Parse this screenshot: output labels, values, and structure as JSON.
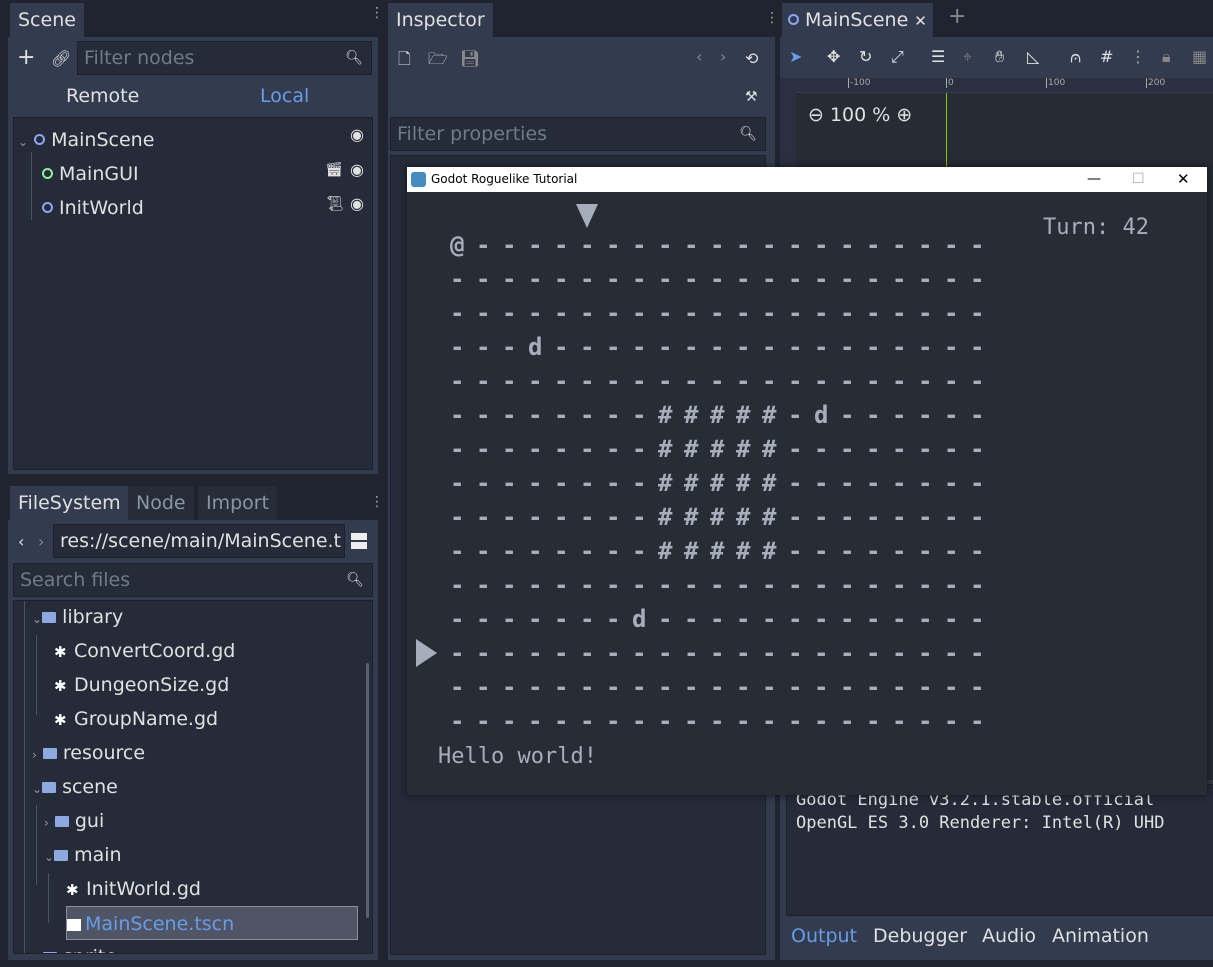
{
  "scene_dock": {
    "tab": "Scene",
    "filter_placeholder": "Filter nodes",
    "remote": "Remote",
    "local": "Local",
    "nodes": [
      {
        "name": "MainScene",
        "color": "#8da5f3"
      },
      {
        "name": "MainGUI",
        "color": "#8eef97"
      },
      {
        "name": "InitWorld",
        "color": "#8da5f3"
      }
    ]
  },
  "filesystem_dock": {
    "tabs": [
      "FileSystem",
      "Node",
      "Import"
    ],
    "path": "res://scene/main/MainScene.t",
    "search_placeholder": "Search files",
    "items": [
      {
        "label": "library",
        "type": "folder",
        "expanded": true
      },
      {
        "label": "ConvertCoord.gd",
        "type": "script"
      },
      {
        "label": "DungeonSize.gd",
        "type": "script"
      },
      {
        "label": "GroupName.gd",
        "type": "script"
      },
      {
        "label": "resource",
        "type": "folder",
        "expanded": false
      },
      {
        "label": "scene",
        "type": "folder",
        "expanded": true
      },
      {
        "label": "gui",
        "type": "folder",
        "expanded": false
      },
      {
        "label": "main",
        "type": "folder",
        "expanded": true
      },
      {
        "label": "InitWorld.gd",
        "type": "script"
      },
      {
        "label": "MainScene.tscn",
        "type": "scene",
        "selected": true
      },
      {
        "label": "sprite",
        "type": "folder",
        "expanded": false
      }
    ]
  },
  "inspector": {
    "tab": "Inspector",
    "filter_placeholder": "Filter properties"
  },
  "editor": {
    "scene_tab": "MainScene",
    "zoom": "100 %",
    "ruler_labels": [
      "-100",
      "0",
      "100",
      "200"
    ],
    "accent": "#699ce8"
  },
  "bottom_panel": {
    "output_lines": [
      "Godot Engine v3.2.1.stable.official",
      "OpenGL ES 3.0 Renderer: Intel(R) UHD"
    ],
    "tabs": [
      "Output",
      "Debugger",
      "Audio",
      "Animation"
    ]
  },
  "game_window": {
    "title": "Godot Roguelike Tutorial",
    "turn": "Turn: 42",
    "message": "Hello world!",
    "map": [
      "@--------------------",
      "---------------------",
      "---------------------",
      "---d-----------------",
      "---------------------",
      "--------#####-d------",
      "--------#####--------",
      "--------#####--------",
      "--------#####--------",
      "--------#####--------",
      "---------------------",
      "-------d-------------",
      "---------------------",
      "---------------------",
      "---------------------"
    ],
    "column_indicator": 5,
    "row_indicator": 12
  }
}
